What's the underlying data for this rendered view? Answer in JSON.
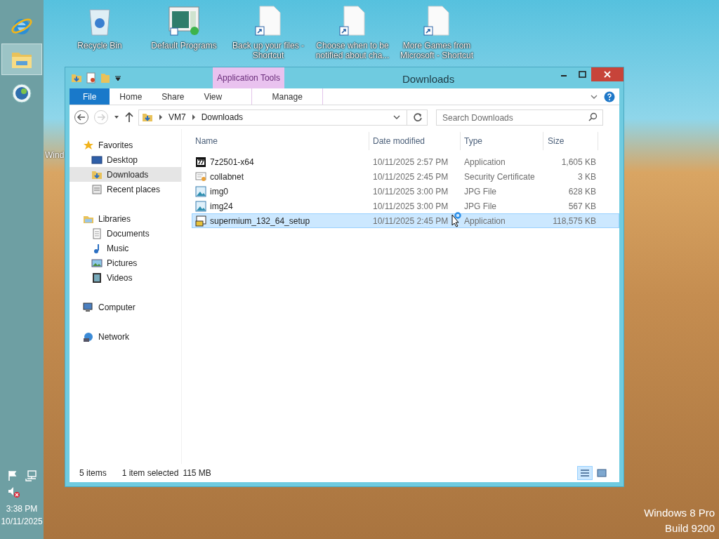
{
  "taskbar": {
    "apps": [
      {
        "kind": "browser",
        "selected": false
      },
      {
        "kind": "explorer",
        "selected": true
      },
      {
        "kind": "media",
        "selected": false
      }
    ],
    "clock": {
      "time": "3:38 PM",
      "date": "10/11/2025"
    },
    "volume_muted": true
  },
  "desktop": {
    "icons": [
      {
        "kind": "recycle",
        "label": "Recycle Bin"
      },
      {
        "kind": "programs",
        "label": "Default Programs"
      },
      {
        "kind": "shortcut",
        "label": "Back up your files - Shortcut"
      },
      {
        "kind": "shortcut",
        "label": "Choose when to be notified about cha..."
      },
      {
        "kind": "shortcut",
        "label": "More Games from Microsoft - Shortcut"
      }
    ],
    "partial_labels": [
      "Wind"
    ],
    "watermark": [
      "Windows 8 Pro",
      "Build 9200"
    ]
  },
  "window": {
    "title": "Downloads",
    "context_tab_group": "Application Tools",
    "ribbon_tabs": [
      {
        "label": "File",
        "kind": "file",
        "selected": false
      },
      {
        "label": "Home",
        "kind": "tab",
        "selected": false
      },
      {
        "label": "Share",
        "kind": "tab",
        "selected": false
      },
      {
        "label": "View",
        "kind": "tab",
        "selected": false
      },
      {
        "label": "Manage",
        "kind": "context",
        "selected": false
      }
    ],
    "address": {
      "path": [
        "VM7",
        "Downloads"
      ]
    },
    "search": {
      "placeholder": "Search Downloads"
    },
    "nav": [
      {
        "label": "Favorites",
        "selected": false,
        "children": [
          {
            "label": "Desktop",
            "selected": false
          },
          {
            "label": "Downloads",
            "selected": true
          },
          {
            "label": "Recent places",
            "selected": false
          }
        ]
      },
      {
        "label": "Libraries",
        "selected": false,
        "children": [
          {
            "label": "Documents",
            "selected": false
          },
          {
            "label": "Music",
            "selected": false
          },
          {
            "label": "Pictures",
            "selected": false
          },
          {
            "label": "Videos",
            "selected": false
          }
        ]
      },
      {
        "label": "Computer",
        "selected": false
      },
      {
        "label": "Network",
        "selected": false
      }
    ],
    "columns": [
      "Name",
      "Date modified",
      "Type",
      "Size"
    ],
    "files": [
      {
        "name": "7z2501-x64",
        "kind": "archiver",
        "date": "10/11/2025 2:57 PM",
        "type": "Application",
        "size": "1,605 KB",
        "selected": false
      },
      {
        "name": "collabnet",
        "kind": "certificate",
        "date": "10/11/2025 2:45 PM",
        "type": "Security Certificate",
        "size": "3 KB",
        "selected": false
      },
      {
        "name": "img0",
        "kind": "image",
        "date": "10/11/2025 3:00 PM",
        "type": "JPG File",
        "size": "628 KB",
        "selected": false
      },
      {
        "name": "img24",
        "kind": "image",
        "date": "10/11/2025 3:00 PM",
        "type": "JPG File",
        "size": "567 KB",
        "selected": false
      },
      {
        "name": "supermium_132_64_setup",
        "kind": "installer",
        "date": "10/11/2025 2:45 PM",
        "type": "Application",
        "size": "118,575 KB",
        "selected": true
      }
    ],
    "status": {
      "count": "5 items",
      "selection": "1 item selected",
      "selection_size": "115 MB"
    },
    "view_buttons": [
      {
        "kind": "details",
        "selected": true
      },
      {
        "kind": "tiles",
        "selected": false
      }
    ]
  }
}
